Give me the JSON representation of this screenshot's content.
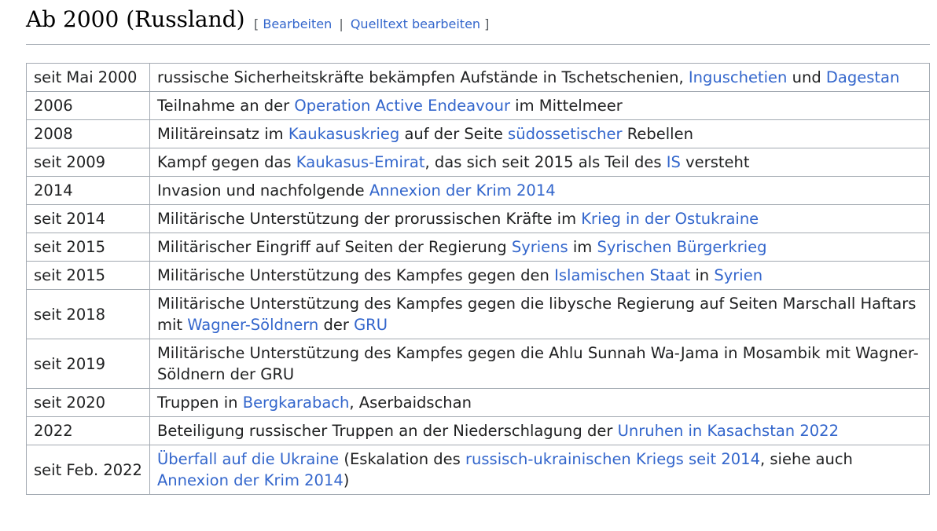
{
  "section": {
    "title": "Ab 2000 (Russland)",
    "edit_open": "[",
    "edit_label": "Bearbeiten",
    "edit_separator": "|",
    "edit_source_label": "Quelltext bearbeiten",
    "edit_close": "]"
  },
  "table": {
    "rows": [
      {
        "year": "seit Mai 2000",
        "parts": [
          {
            "t": "russische Sicherheitskräfte bekämpfen Aufstände in Tschetschenien, "
          },
          {
            "t": "Inguschetien",
            "link": true
          },
          {
            "t": " und "
          },
          {
            "t": "Dagestan",
            "link": true
          }
        ]
      },
      {
        "year": "2006",
        "parts": [
          {
            "t": "Teilnahme an der "
          },
          {
            "t": "Operation Active Endeavour",
            "link": true
          },
          {
            "t": " im Mittelmeer"
          }
        ]
      },
      {
        "year": "2008",
        "parts": [
          {
            "t": "Militäreinsatz im "
          },
          {
            "t": "Kaukasuskrieg",
            "link": true
          },
          {
            "t": " auf der Seite "
          },
          {
            "t": "südossetischer",
            "link": true
          },
          {
            "t": " Rebellen"
          }
        ]
      },
      {
        "year": "seit 2009",
        "parts": [
          {
            "t": "Kampf gegen das "
          },
          {
            "t": "Kaukasus-Emirat",
            "link": true
          },
          {
            "t": ", das sich seit 2015 als Teil des "
          },
          {
            "t": "IS",
            "link": true
          },
          {
            "t": " versteht"
          }
        ]
      },
      {
        "year": "2014",
        "parts": [
          {
            "t": "Invasion und nachfolgende "
          },
          {
            "t": "Annexion der Krim 2014",
            "link": true
          }
        ]
      },
      {
        "year": "seit 2014",
        "parts": [
          {
            "t": "Militärische Unterstützung der prorussischen Kräfte im "
          },
          {
            "t": "Krieg in der Ostukraine",
            "link": true
          }
        ]
      },
      {
        "year": "seit 2015",
        "parts": [
          {
            "t": "Militärischer Eingriff auf Seiten der Regierung "
          },
          {
            "t": "Syriens",
            "link": true
          },
          {
            "t": " im "
          },
          {
            "t": "Syrischen Bürgerkrieg",
            "link": true
          }
        ]
      },
      {
        "year": "seit 2015",
        "parts": [
          {
            "t": "Militärische Unterstützung des Kampfes gegen den "
          },
          {
            "t": "Islamischen Staat",
            "link": true
          },
          {
            "t": " in "
          },
          {
            "t": "Syrien",
            "link": true
          }
        ]
      },
      {
        "year": "seit 2018",
        "tall": true,
        "parts": [
          {
            "t": "Militärische Unterstützung des Kampfes gegen die libysche Regierung auf Seiten Marschall Haftars mit "
          },
          {
            "t": "Wagner-Söldnern",
            "link": true
          },
          {
            "t": " der "
          },
          {
            "t": "GRU",
            "link": true
          }
        ]
      },
      {
        "year": "seit 2019",
        "tall": true,
        "parts": [
          {
            "t": "Militärische Unterstützung des Kampfes gegen die Ahlu Sunnah Wa-Jama in Mosambik mit Wagner-Söldnern der GRU"
          }
        ]
      },
      {
        "year": "seit 2020",
        "parts": [
          {
            "t": "Truppen in "
          },
          {
            "t": "Bergkarabach",
            "link": true
          },
          {
            "t": ", Aserbaidschan"
          }
        ]
      },
      {
        "year": "2022",
        "parts": [
          {
            "t": "Beteiligung russischer Truppen an der Niederschlagung der "
          },
          {
            "t": "Unruhen in Kasachstan 2022",
            "link": true
          }
        ]
      },
      {
        "year": "seit Feb. 2022",
        "tall": true,
        "parts": [
          {
            "t": "Überfall auf die Ukraine",
            "link": true
          },
          {
            "t": " (Eskalation des "
          },
          {
            "t": "russisch-ukrainischen Kriegs seit 2014",
            "link": true
          },
          {
            "t": ", siehe auch "
          },
          {
            "t": "Annexion der Krim 2014",
            "link": true
          },
          {
            "t": ")"
          }
        ]
      }
    ]
  },
  "colors": {
    "link": "#3366cc",
    "border": "#a2a9b1",
    "text": "#202122"
  }
}
